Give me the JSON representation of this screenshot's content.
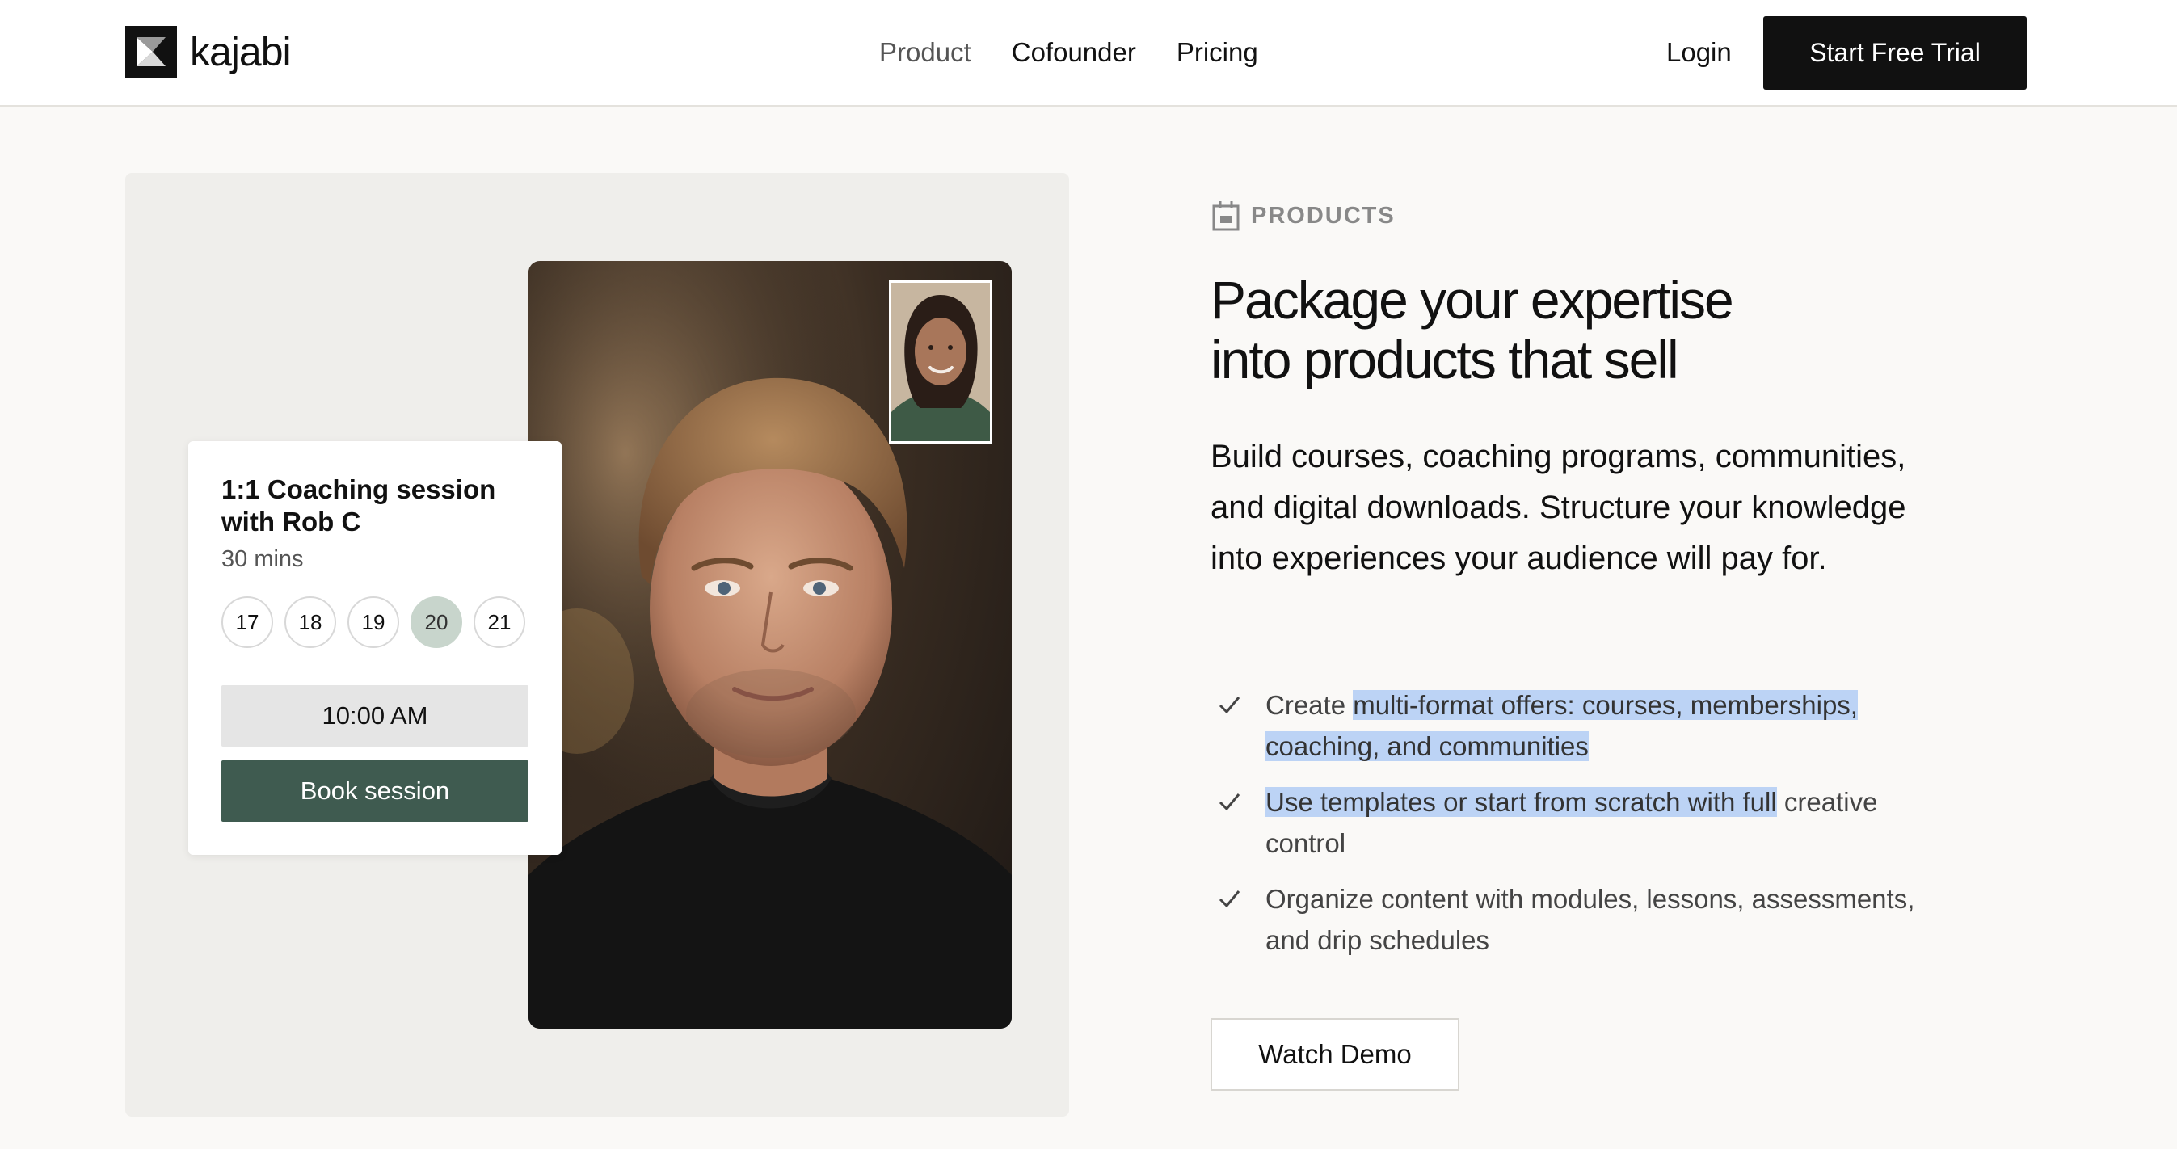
{
  "nav": {
    "logo_text": "kajabi",
    "links": [
      "Product",
      "Cofounder",
      "Pricing"
    ],
    "login_label": "Login",
    "cta_label": "Start Free Trial"
  },
  "booking_card": {
    "title": "1:1 Coaching session with Rob C",
    "duration": "30 mins",
    "dates": [
      "17",
      "18",
      "19",
      "20",
      "21"
    ],
    "selected_date": "20",
    "time_slot": "10:00 AM",
    "book_label": "Book session",
    "accent_color": "#3f5b50"
  },
  "section": {
    "eyebrow": "PRODUCTS",
    "eyebrow_icon": "calendar-icon",
    "headline_lines": [
      "Package your expertise",
      "into products that sell"
    ],
    "lead": "Build courses, coaching programs, communities, and digital downloads. Structure your knowledge into experiences your audience will pay for.",
    "features": [
      {
        "pre": "Create ",
        "highlight": "multi-format offers: courses, memberships, coaching, and communities",
        "post": ""
      },
      {
        "pre": "",
        "highlight": "Use templates or start from scratch with full",
        "post": " creative control"
      },
      {
        "pre": "Organize content with modules, lessons, assessments, and drip schedules",
        "highlight": "",
        "post": ""
      }
    ],
    "demo_label": "Watch Demo",
    "selection_color": "#bcd3f5"
  }
}
